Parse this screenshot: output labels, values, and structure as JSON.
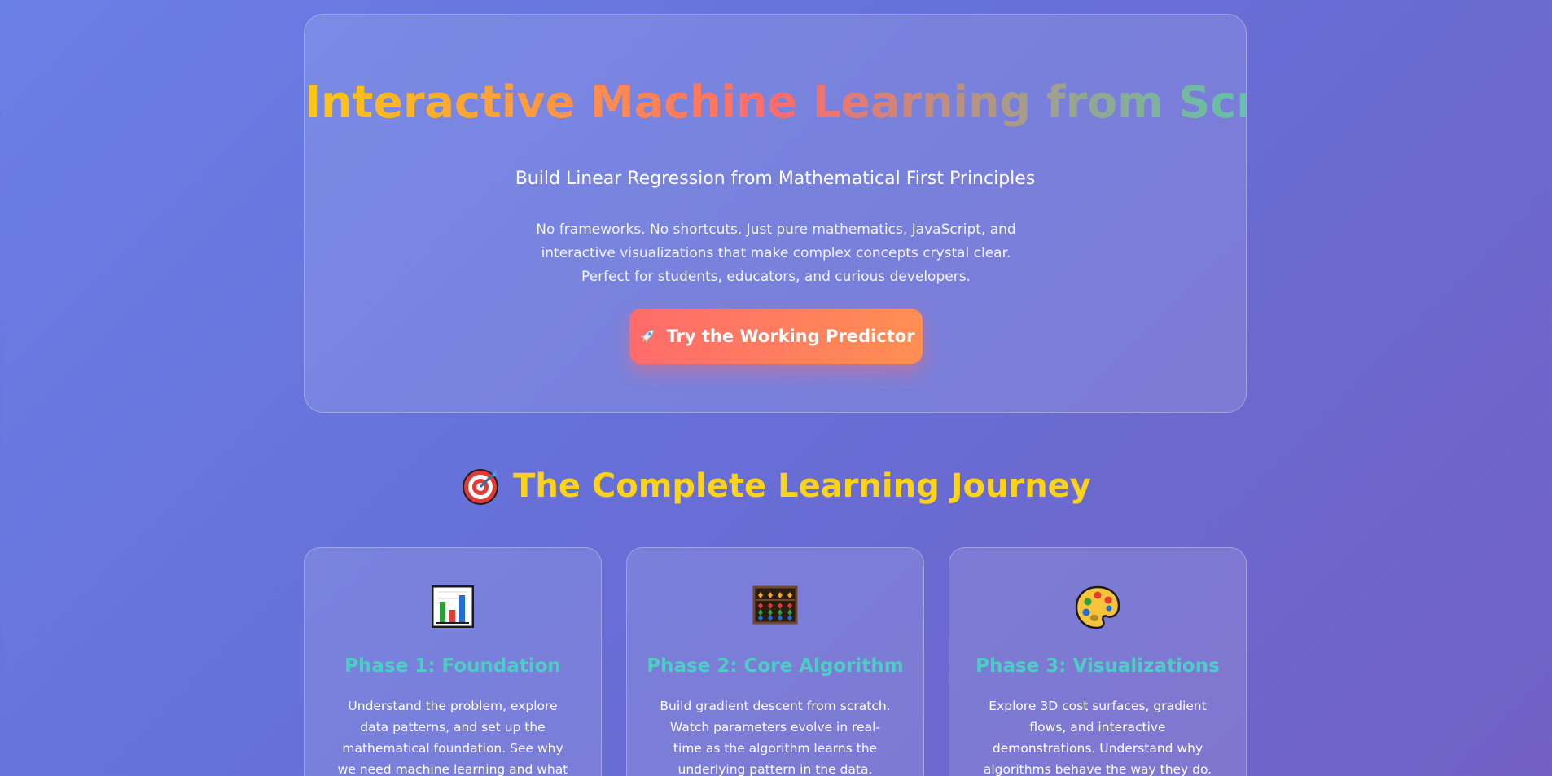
{
  "hero": {
    "title": "Interactive Machine Learning from Scratch",
    "subtitle": "Build Linear Regression from Mathematical First Principles",
    "description": "No frameworks. No shortcuts. Just pure mathematics, JavaScript, and interactive visualizations that make complex concepts crystal clear. Perfect for students, educators, and curious developers.",
    "cta_icon": "rocket-icon",
    "cta_label": "Try the Working Predictor"
  },
  "journey": {
    "icon": "target-icon",
    "title": "The Complete Learning Journey",
    "cards": [
      {
        "icon": "bar-chart-icon",
        "title": "Phase 1: Foundation",
        "description": "Understand the problem, explore data patterns, and set up the mathematical foundation. See why we need machine learning and what we're trying to solve."
      },
      {
        "icon": "abacus-icon",
        "title": "Phase 2: Core Algorithm",
        "description": "Build gradient descent from scratch. Watch parameters evolve in real-time as the algorithm learns the underlying pattern in the data."
      },
      {
        "icon": "palette-icon",
        "title": "Phase 3: Visualizations",
        "description": "Explore 3D cost surfaces, gradient flows, and interactive demonstrations. Understand why algorithms behave the way they do."
      }
    ]
  },
  "colors": {
    "accent_yellow": "#fdd318",
    "accent_teal": "#4ecdc4",
    "cta_start": "#ff6b6b",
    "cta_end": "#ff8e53"
  }
}
